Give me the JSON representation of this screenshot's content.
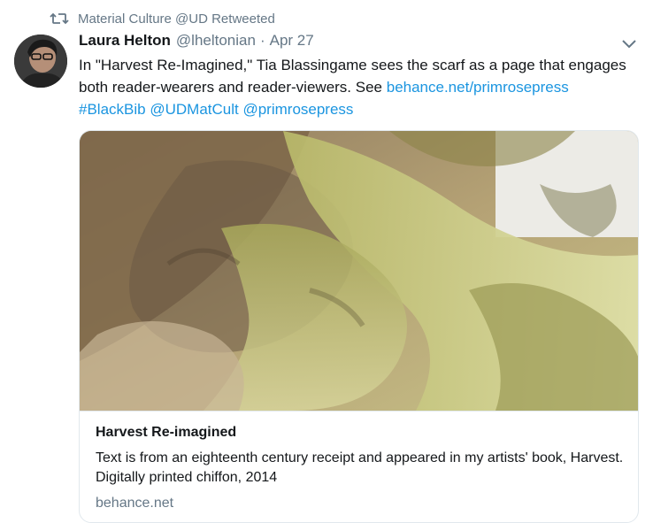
{
  "retweet": {
    "icon": "retweet-icon",
    "text": "Material Culture @UD Retweeted"
  },
  "tweet": {
    "author_name": "Laura Helton",
    "handle": "@lheltonian",
    "separator": "·",
    "date": "Apr 27",
    "text_start": "In \"Harvest Re-Imagined,\" Tia Blassingame sees the scarf as a page that engages both reader-wearers and reader-viewers. See ",
    "link": "behance.net/primrosepress",
    "hashtag": "#BlackBib",
    "mention_1": "@UDMatCult",
    "mention_2": "@primrosepress"
  },
  "card": {
    "title": "Harvest Re-imagined",
    "description": "Text is from an eighteenth century receipt and appeared in my artists' book, Harvest. Digitally printed chiffon, 2014",
    "domain": "behance.net"
  },
  "colors": {
    "link": "#1b95e0",
    "secondary_text": "#657786",
    "border": "#e1e8ed"
  }
}
